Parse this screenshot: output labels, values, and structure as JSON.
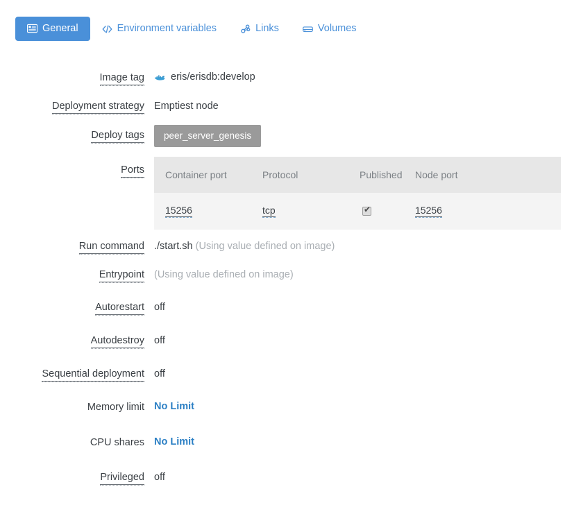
{
  "tabs": [
    {
      "label": "General",
      "icon": "list-alt-icon",
      "active": true
    },
    {
      "label": "Environment variables",
      "icon": "code-icon",
      "active": false
    },
    {
      "label": "Links",
      "icon": "link-chain-icon",
      "active": false
    },
    {
      "label": "Volumes",
      "icon": "hdd-icon",
      "active": false
    }
  ],
  "colors": {
    "accent_blue": "#4a90d9",
    "link_blue": "#2b7fc4",
    "badge_grey": "#9a9a9a",
    "table_header_bg": "#e7e7e7",
    "table_row_bg": "#f4f4f4",
    "muted_text": "#a9aeb3"
  },
  "fields": {
    "image_tag": {
      "label": "Image tag",
      "value": "eris/erisdb:develop",
      "icon": "docker-whale-icon"
    },
    "deployment_strategy": {
      "label": "Deployment strategy",
      "value": "Emptiest node"
    },
    "deploy_tags": {
      "label": "Deploy tags",
      "tags": [
        "peer_server_genesis"
      ]
    },
    "ports": {
      "label": "Ports",
      "columns": [
        "Container port",
        "Protocol",
        "Published",
        "Node port"
      ],
      "rows": [
        {
          "container_port": "15256",
          "protocol": "tcp",
          "published": true,
          "node_port": "15256"
        }
      ]
    },
    "run_command": {
      "label": "Run command",
      "value": "./start.sh",
      "hint": "(Using value defined on image)"
    },
    "entrypoint": {
      "label": "Entrypoint",
      "value": "",
      "hint": "(Using value defined on image)"
    },
    "autorestart": {
      "label": "Autorestart",
      "value": "off"
    },
    "autodestroy": {
      "label": "Autodestroy",
      "value": "off"
    },
    "sequential_deployment": {
      "label": "Sequential deployment",
      "value": "off"
    },
    "memory_limit": {
      "label": "Memory limit",
      "value": "No Limit"
    },
    "cpu_shares": {
      "label": "CPU shares",
      "value": "No Limit"
    },
    "privileged": {
      "label": "Privileged",
      "value": "off"
    }
  }
}
